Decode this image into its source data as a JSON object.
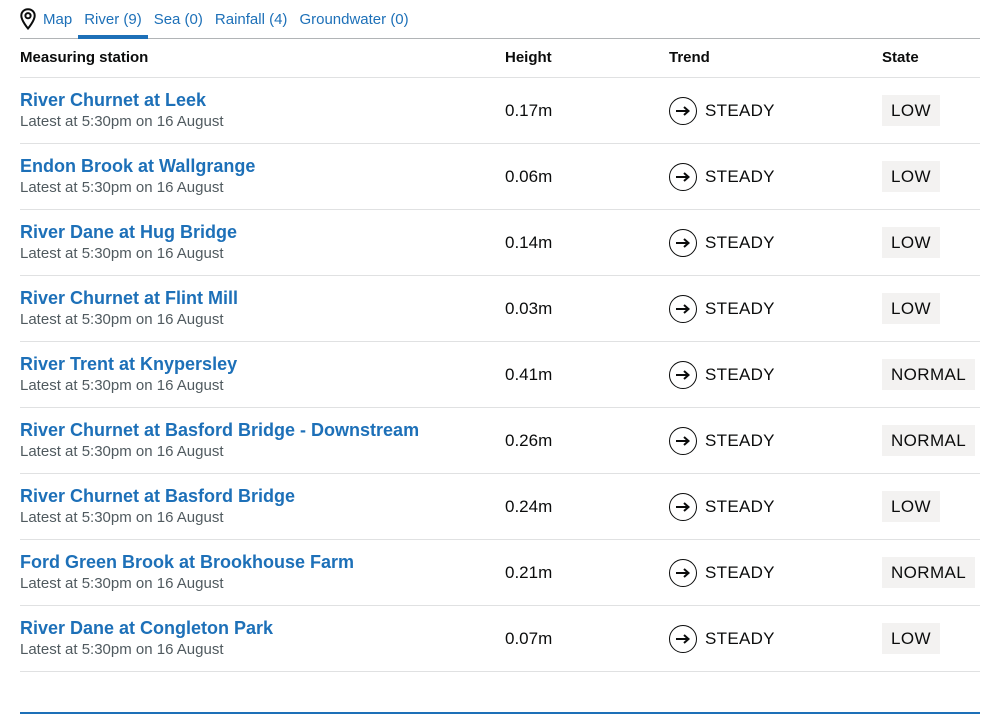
{
  "tabs": [
    {
      "label": "Map",
      "icon": "map-pin-icon"
    },
    {
      "label": "River (9)",
      "active": true
    },
    {
      "label": "Sea (0)"
    },
    {
      "label": "Rainfall (4)"
    },
    {
      "label": "Groundwater (0)"
    }
  ],
  "table": {
    "headers": {
      "station": "Measuring station",
      "height": "Height",
      "trend": "Trend",
      "state": "State"
    },
    "rows": [
      {
        "station": "River Churnet at Leek",
        "latest": "Latest at 5:30pm on 16 August",
        "height": "0.17m",
        "trend": "STEADY",
        "state": "LOW"
      },
      {
        "station": "Endon Brook at Wallgrange",
        "latest": "Latest at 5:30pm on 16 August",
        "height": "0.06m",
        "trend": "STEADY",
        "state": "LOW"
      },
      {
        "station": "River Dane at Hug Bridge",
        "latest": "Latest at 5:30pm on 16 August",
        "height": "0.14m",
        "trend": "STEADY",
        "state": "LOW"
      },
      {
        "station": "River Churnet at Flint Mill",
        "latest": "Latest at 5:30pm on 16 August",
        "height": "0.03m",
        "trend": "STEADY",
        "state": "LOW"
      },
      {
        "station": "River Trent at Knypersley",
        "latest": "Latest at 5:30pm on 16 August",
        "height": "0.41m",
        "trend": "STEADY",
        "state": "NORMAL"
      },
      {
        "station": "River Churnet at Basford Bridge - Downstream",
        "latest": "Latest at 5:30pm on 16 August",
        "height": "0.26m",
        "trend": "STEADY",
        "state": "NORMAL"
      },
      {
        "station": "River Churnet at Basford Bridge",
        "latest": "Latest at 5:30pm on 16 August",
        "height": "0.24m",
        "trend": "STEADY",
        "state": "LOW"
      },
      {
        "station": "Ford Green Brook at Brookhouse Farm",
        "latest": "Latest at 5:30pm on 16 August",
        "height": "0.21m",
        "trend": "STEADY",
        "state": "NORMAL"
      },
      {
        "station": "River Dane at Congleton Park",
        "latest": "Latest at 5:30pm on 16 August",
        "height": "0.07m",
        "trend": "STEADY",
        "state": "LOW"
      }
    ]
  },
  "colors": {
    "link": "#1d70b8",
    "text": "#0b0c0c",
    "secondary_text": "#505a5f",
    "badge_bg": "#f3f2f1"
  }
}
